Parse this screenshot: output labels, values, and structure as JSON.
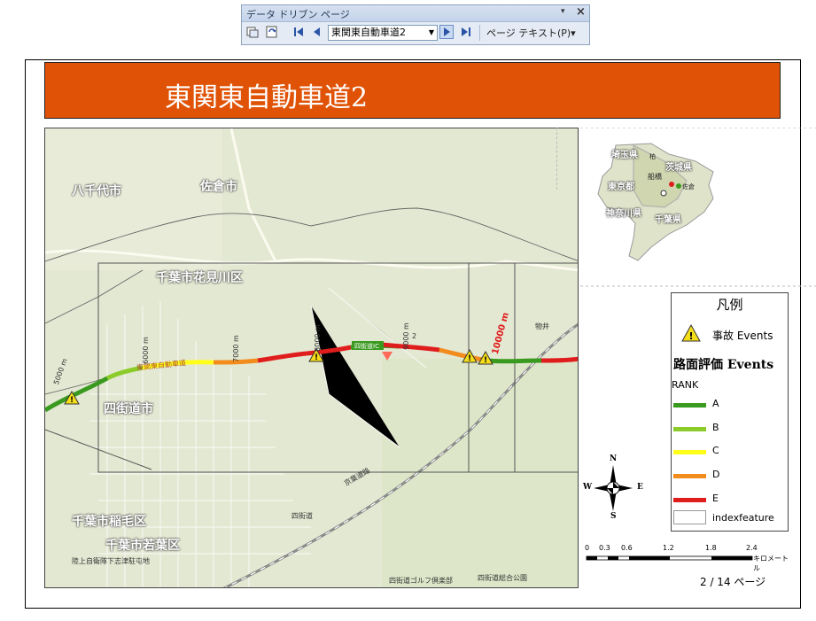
{
  "toolbar": {
    "title": "データ ドリブン ページ",
    "menu_glyph": "▾",
    "close_glyph": "×",
    "current_page": "東関東自動車道2",
    "page_text_label": "ページ テキスト(P)▾",
    "icons": [
      "refresh-icon",
      "options-icon",
      "first-page-icon",
      "previous-page-icon",
      "next-page-icon",
      "last-page-icon"
    ]
  },
  "layout": {
    "title": "東関東自動車道2",
    "page_number": "2 / 14 ページ"
  },
  "map": {
    "place_labels": [
      "八千代市",
      "佐倉市",
      "千葉市花見川区",
      "四街道市",
      "千葉市稲毛区",
      "千葉市若葉区"
    ],
    "small_labels": [
      "四街道IC",
      "四街道",
      "物井",
      "陸上自衛隊下志津駐屯地",
      "四街道ゴルフ倶楽部",
      "四街道総合公園",
      "東関東自動車道",
      "京葉道路"
    ],
    "chainage_labels": [
      "5000 m",
      "6000 m",
      "7000 m",
      "8000 m",
      "9000 m",
      "10000 m"
    ],
    "chainage_mark": "2"
  },
  "inset": {
    "labels": [
      "埼玉県",
      "茨城県",
      "東京都",
      "船橋",
      "神奈川県",
      "千葉県",
      "柏",
      "佐倉"
    ]
  },
  "legend": {
    "title": "凡例",
    "accident_label": "事故 Events",
    "pavement_label": "路面評価 Events",
    "rank_label": "RANK",
    "ranks": [
      {
        "label": "A",
        "color": "#3a9a1f"
      },
      {
        "label": "B",
        "color": "#8ccc2a"
      },
      {
        "label": "C",
        "color": "#ffff1a"
      },
      {
        "label": "D",
        "color": "#f28c1c"
      },
      {
        "label": "E",
        "color": "#e01d1d"
      }
    ],
    "index_label": "indexfeature"
  },
  "compass": {
    "n": "N",
    "s": "S",
    "e": "E",
    "w": "W"
  },
  "scale": {
    "ticks": [
      "0",
      "0.3",
      "0.6",
      "1.2",
      "1.8",
      "2.4"
    ],
    "unit": "キロメートル"
  },
  "colors": {
    "title_bg": "#e05306",
    "warning": "#f5dd18"
  }
}
